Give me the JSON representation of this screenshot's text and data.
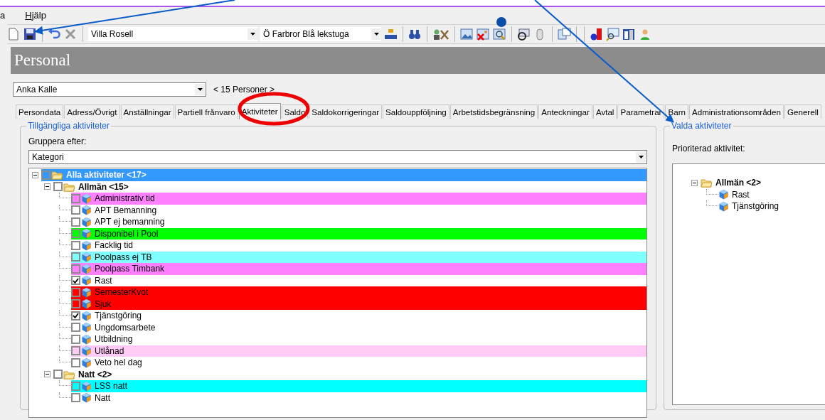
{
  "menu": [
    {
      "label": "a"
    },
    {
      "label": "Hjälp"
    }
  ],
  "toolbar": {
    "combos": [
      {
        "value": "Villa Rosell"
      },
      {
        "value": "Ö Farbror Blå lekstuga"
      }
    ]
  },
  "header": {
    "title": "Personal"
  },
  "person_select": {
    "value": "Anka Kalle",
    "count": "< 15 Personer >"
  },
  "tabs": [
    {
      "label": "Persondata",
      "selected": false
    },
    {
      "label": "Adress/Övrigt",
      "selected": false
    },
    {
      "label": "Anställningar",
      "selected": false
    },
    {
      "label": "Partiell frånvaro",
      "selected": false
    },
    {
      "label": "Aktiviteter",
      "selected": true
    },
    {
      "label": "Saldo",
      "selected": false
    },
    {
      "label": "Saldokorrigeringar",
      "selected": false
    },
    {
      "label": "Saldouppföljning",
      "selected": false
    },
    {
      "label": "Arbetstidsbegränsning",
      "selected": false
    },
    {
      "label": "Anteckningar",
      "selected": false
    },
    {
      "label": "Avtal",
      "selected": false
    },
    {
      "label": "Parametrar",
      "selected": false
    },
    {
      "label": "Barn",
      "selected": false
    },
    {
      "label": "Administrationsområden",
      "selected": false
    },
    {
      "label": "Generell",
      "selected": false
    }
  ],
  "available": {
    "title": "Tillgängliga aktiviteter",
    "group_by_label": "Gruppera efter:",
    "group_by_value": "Kategori",
    "tree": [
      {
        "kind": "folder",
        "label": "Alla aktiviteter <17>",
        "checked": false,
        "selected": true,
        "expanded": true,
        "children": [
          {
            "kind": "folder",
            "label": "Allmän <15>",
            "checked": false,
            "selected": false,
            "expanded": true,
            "children": [
              {
                "kind": "activity",
                "label": "Administrativ tid",
                "checked": false,
                "selected": false,
                "color": "#ff80ff"
              },
              {
                "kind": "activity",
                "label": "APT Bemanning",
                "checked": false,
                "selected": false
              },
              {
                "kind": "activity",
                "label": "APT ej bemanning",
                "checked": false,
                "selected": false
              },
              {
                "kind": "activity",
                "label": "Disponibel i Pool",
                "checked": false,
                "selected": false,
                "color": "#00ff00"
              },
              {
                "kind": "activity",
                "label": "Facklig tid",
                "checked": false,
                "selected": false
              },
              {
                "kind": "activity",
                "label": "Poolpass ej TB",
                "checked": false,
                "selected": false,
                "color": "#80ffff"
              },
              {
                "kind": "activity",
                "label": "Poolpass Timbank",
                "checked": false,
                "selected": false,
                "color": "#ff80ff"
              },
              {
                "kind": "activity",
                "label": "Rast",
                "checked": true,
                "selected": false
              },
              {
                "kind": "activity",
                "label": "SemesterKvot",
                "checked": false,
                "selected": false,
                "color": "#ff0000"
              },
              {
                "kind": "activity",
                "label": "Sjuk",
                "checked": false,
                "selected": false,
                "color": "#ff0000"
              },
              {
                "kind": "activity",
                "label": "Tjänstgöring",
                "checked": true,
                "selected": false
              },
              {
                "kind": "activity",
                "label": "Ungdomsarbete",
                "checked": false,
                "selected": false
              },
              {
                "kind": "activity",
                "label": "Utbildning",
                "checked": false,
                "selected": false
              },
              {
                "kind": "activity",
                "label": "Utlånad",
                "checked": false,
                "selected": false,
                "color": "#ffccf8"
              },
              {
                "kind": "activity",
                "label": "Veto hel dag",
                "checked": false,
                "selected": false
              }
            ]
          },
          {
            "kind": "folder",
            "label": "Natt <2>",
            "checked": false,
            "selected": false,
            "expanded": true,
            "children": [
              {
                "kind": "activity",
                "label": "LSS natt",
                "checked": false,
                "selected": false,
                "color": "#00ffff"
              },
              {
                "kind": "activity",
                "label": "Natt",
                "checked": false,
                "selected": false
              }
            ]
          }
        ]
      }
    ]
  },
  "chosen": {
    "title": "Valda aktiviteter",
    "priority_label": "Prioriterad aktivitet:",
    "tree": [
      {
        "kind": "folder",
        "label": "Allmän <2>",
        "expanded": true,
        "children": [
          {
            "kind": "activity",
            "label": "Rast"
          },
          {
            "kind": "activity",
            "label": "Tjänstgöring"
          }
        ]
      }
    ]
  }
}
